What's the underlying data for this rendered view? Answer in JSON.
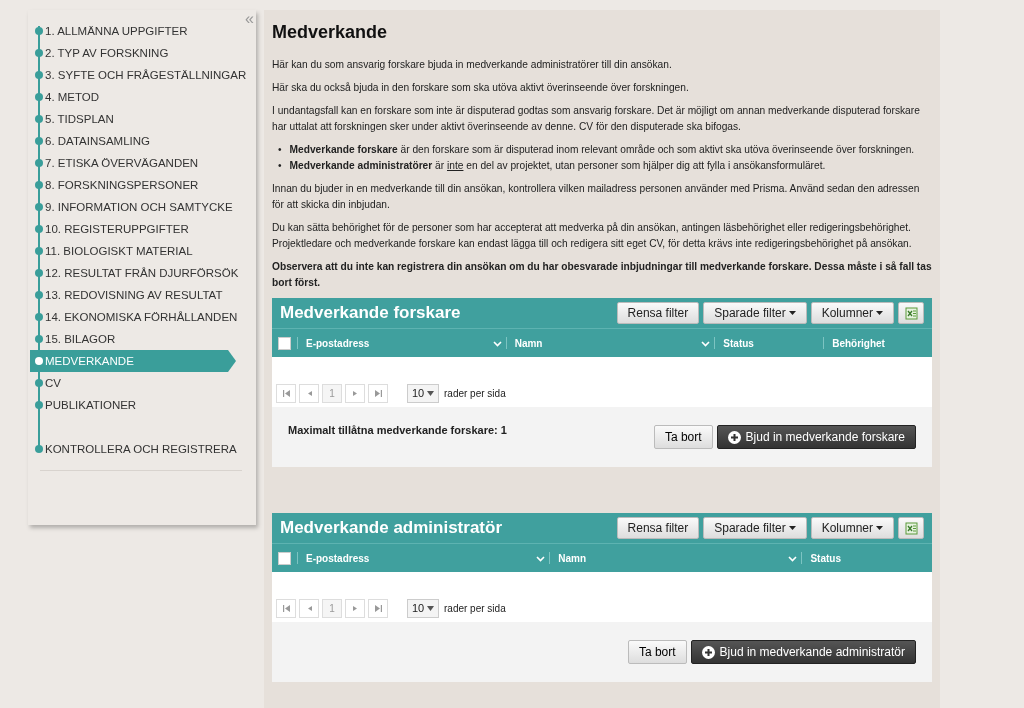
{
  "sidebar": {
    "collapse": "«",
    "items": [
      {
        "label": "1. ALLMÄNNA UPPGIFTER",
        "selected": false
      },
      {
        "label": "2. TYP AV FORSKNING",
        "selected": false
      },
      {
        "label": "3. SYFTE OCH FRÅGESTÄLLNINGAR",
        "selected": false
      },
      {
        "label": "4. METOD",
        "selected": false
      },
      {
        "label": "5. TIDSPLAN",
        "selected": false
      },
      {
        "label": "6. DATAINSAMLING",
        "selected": false
      },
      {
        "label": "7. ETISKA ÖVERVÄGANDEN",
        "selected": false
      },
      {
        "label": "8. FORSKNINGSPERSONER",
        "selected": false
      },
      {
        "label": "9. INFORMATION OCH SAMTYCKE",
        "selected": false
      },
      {
        "label": "10. REGISTERUPPGIFTER",
        "selected": false
      },
      {
        "label": "11. BIOLOGISKT MATERIAL",
        "selected": false
      },
      {
        "label": "12. RESULTAT FRÅN DJURFÖRSÖK",
        "selected": false
      },
      {
        "label": "13. REDOVISNING AV RESULTAT",
        "selected": false
      },
      {
        "label": "14. EKONOMISKA FÖRHÅLLANDEN",
        "selected": false
      },
      {
        "label": "15. BILAGOR",
        "selected": false
      },
      {
        "label": "MEDVERKANDE",
        "selected": true
      },
      {
        "label": "CV",
        "selected": false
      },
      {
        "label": "PUBLIKATIONER",
        "selected": false
      }
    ],
    "final_item": {
      "label": "KONTROLLERA OCH REGISTRERA",
      "selected": false
    }
  },
  "page": {
    "title": "Medverkande",
    "intro": [
      "Här kan du som ansvarig forskare bjuda in medverkande administratörer till din ansökan.",
      "Här ska du också bjuda in den forskare som ska utöva aktivt överinseende över forskningen.",
      "I undantagsfall kan en forskare som inte är disputerad godtas som ansvarig forskare. Det är möjligt om annan medverkande disputerad forskare har uttalat att forskningen sker under aktivt överinseende av denne. CV för den disputerade ska bifogas."
    ],
    "bullets": [
      {
        "marker": "•",
        "segments": [
          {
            "kind": "bold",
            "text": "Medverkande forskare"
          },
          {
            "kind": "plain",
            "text": " är den forskare som är disputerad inom relevant område och som aktivt ska utöva överinseende över forskningen."
          }
        ]
      },
      {
        "marker": "•",
        "segments": [
          {
            "kind": "bold",
            "text": "Medverkande administratörer"
          },
          {
            "kind": "plain",
            "text": " är "
          },
          {
            "kind": "underline",
            "text": "inte"
          },
          {
            "kind": "plain",
            "text": " en del av projektet, utan personer som hjälper dig att fylla i ansökansformuläret."
          }
        ]
      }
    ],
    "outro": [
      "Innan du bjuder in en medverkande till din ansökan, kontrollera vilken mailadress personen använder med Prisma. Använd sedan den adressen för att skicka din inbjudan.",
      "Du kan sätta behörighet för de personer som har accepterat att medverka på din ansökan, antingen läsbehörighet eller redigeringsbehörighet. Projektledare och medverkande forskare kan endast lägga till och redigera sitt eget CV, för detta krävs inte redigeringsbehörighet på ansökan."
    ],
    "warning": "Observera att du inte kan registrera din ansökan om du har obesvarade inbjudningar till medverkande forskare. Dessa måste i så fall tas bort först."
  },
  "tables": [
    {
      "title": "Medverkande forskare",
      "select_all_checked": false,
      "toolbar": [
        "Rensa filter",
        "Sparade filter",
        "Kolumner"
      ],
      "columns": [
        {
          "label": "E-postadress",
          "filter": true
        },
        {
          "label": "Namn",
          "filter": true
        },
        {
          "label": "Status",
          "filter": false
        },
        {
          "label": "Behörighet",
          "filter": false
        }
      ],
      "pager": {
        "page": "1",
        "page_size": "10",
        "per_page_label": "rader per sida"
      },
      "note": "Maximalt tillåtna medverkande forskare: 1",
      "remove_button": "Ta bort",
      "invite_button": "Bjud in medverkande forskare"
    },
    {
      "title": "Medverkande administratör",
      "select_all_checked": false,
      "toolbar": [
        "Rensa filter",
        "Sparade filter",
        "Kolumner"
      ],
      "columns": [
        {
          "label": "E-postadress",
          "filter": true
        },
        {
          "label": "Namn",
          "filter": true
        },
        {
          "label": "Status",
          "filter": false
        }
      ],
      "pager": {
        "page": "1",
        "page_size": "10",
        "per_page_label": "rader per sida"
      },
      "remove_button": "Ta bort",
      "invite_button": "Bjud in medverkande administratör"
    }
  ]
}
